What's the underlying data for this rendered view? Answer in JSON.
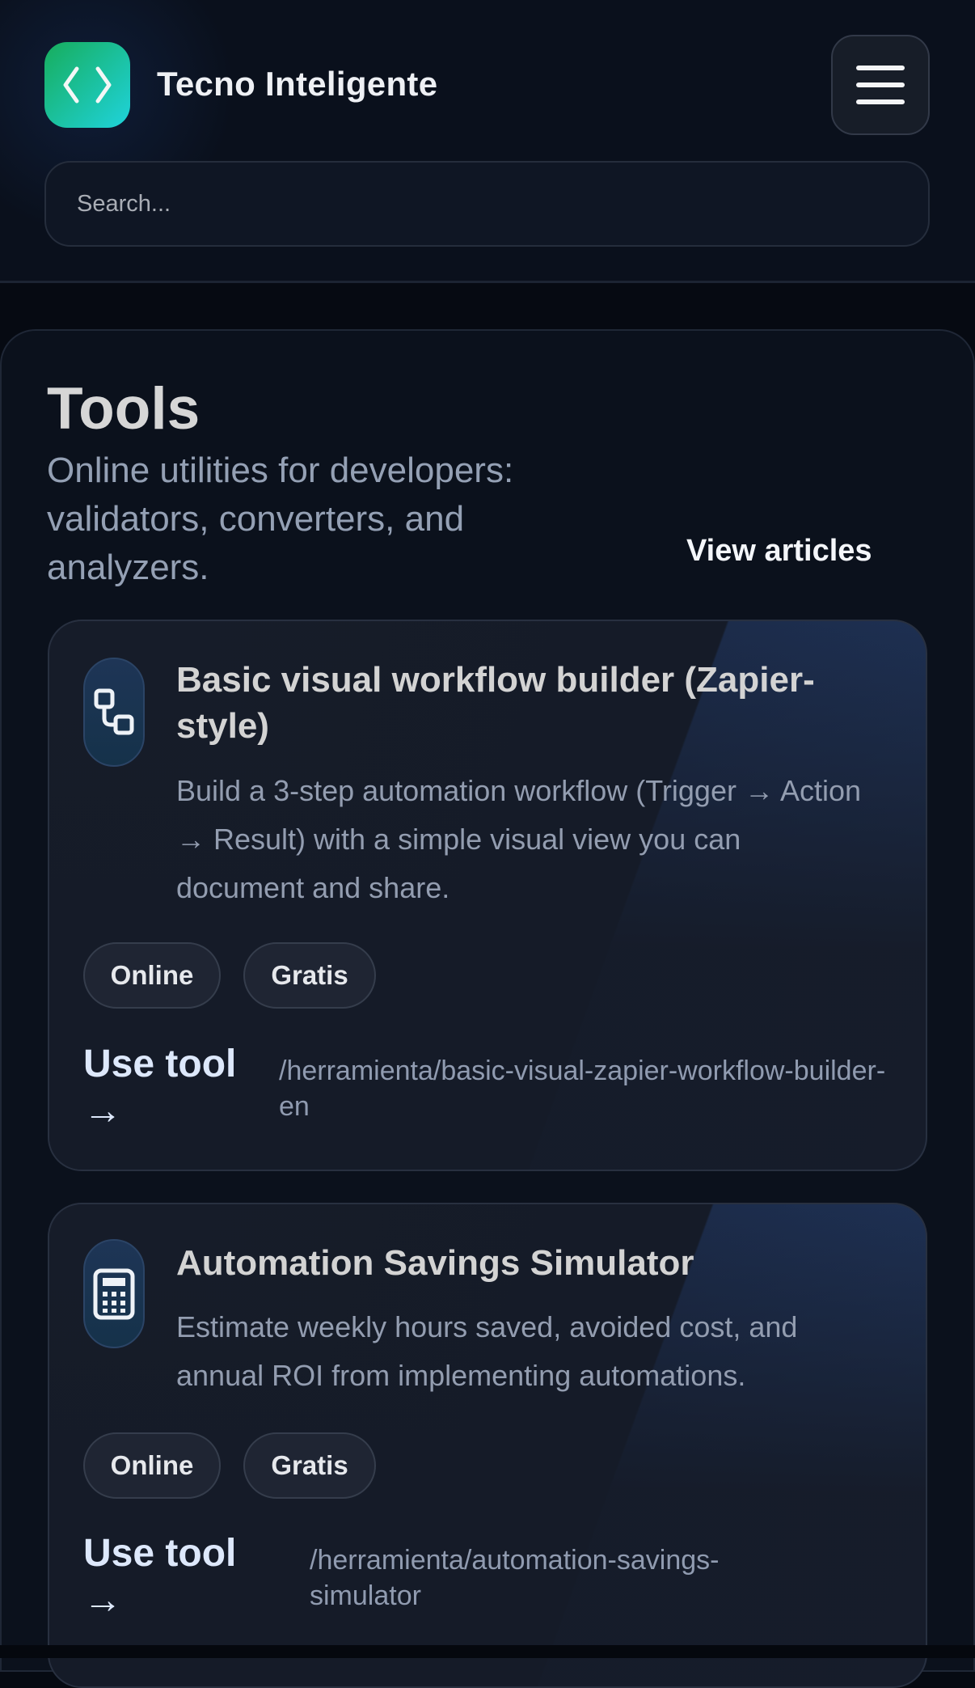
{
  "header": {
    "brand": "Tecno Inteligente",
    "search_placeholder": "Search..."
  },
  "page": {
    "title": "Tools",
    "subtitle": "Online utilities for developers: validators, converters, and analyzers.",
    "view_articles": "View articles"
  },
  "tools": [
    {
      "title": "Basic visual workflow builder (Zapier-style)",
      "description": "Build a 3-step automation workflow (Trigger → Action → Result) with a simple visual view you can document and share.",
      "tags": [
        "Online",
        "Gratis"
      ],
      "cta": "Use tool →",
      "url": "/herramienta/basic-visual-zapier-workflow-builder-en",
      "icon": "workflow-icon"
    },
    {
      "title": "Automation Savings Simulator",
      "description": "Estimate weekly hours saved, avoided cost, and annual ROI from implementing automations.",
      "tags": [
        "Online",
        "Gratis"
      ],
      "cta": "Use tool →",
      "url": "/herramienta/automation-savings-simulator",
      "icon": "calculator-icon"
    }
  ]
}
